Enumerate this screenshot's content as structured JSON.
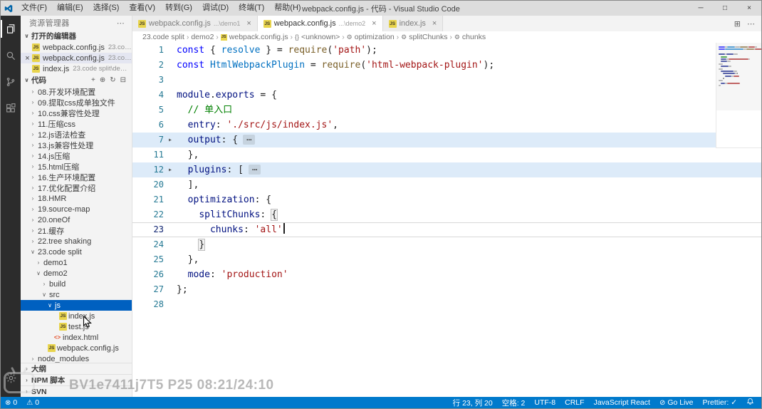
{
  "colors": {
    "accent": "#007acc",
    "titlebar_bg": "#dddddd",
    "activity_bar_bg": "#2c2c2c",
    "sidebar_bg": "#f3f3f3",
    "selection_bg": "#0060c0",
    "fold_highlight": "#ddebf9",
    "editor_bg": "#ffffff",
    "line_number": "#237893",
    "line_number_active": "#0b216f",
    "syntax": {
      "keyword": "#0000ff",
      "variable": "#0070c1",
      "function": "#795e26",
      "string": "#a31515",
      "comment": "#008000",
      "property": "#001080",
      "default": "#1e1e1e"
    }
  },
  "icons": {
    "close": "×",
    "more": "⋯",
    "ellipsis": "⋯",
    "fold_arrow": "▸",
    "chevron_down": "∨",
    "chevron_right": "›",
    "split_editor": "⊞",
    "error": "⊗",
    "warning": "⚠",
    "go_live": "⊘",
    "js_badge": "JS",
    "html_badge": "<>",
    "wrench": "⚙",
    "symbol": "{}",
    "breadcrumb_sep": "›",
    "new_file": "+",
    "new_folder": "⊕",
    "refresh": "↻",
    "collapse_all": "⊟",
    "minimize": "─",
    "maximize": "□"
  },
  "title_bar": {
    "title": "webpack.config.js - 代码 - Visual Studio Code",
    "menus": [
      {
        "name": "file",
        "label": "文件(F)"
      },
      {
        "name": "edit",
        "label": "编辑(E)"
      },
      {
        "name": "selection",
        "label": "选择(S)"
      },
      {
        "name": "view",
        "label": "查看(V)"
      },
      {
        "name": "go",
        "label": "转到(G)"
      },
      {
        "name": "debug",
        "label": "调试(D)"
      },
      {
        "name": "terminal",
        "label": "终端(T)"
      },
      {
        "name": "help",
        "label": "帮助(H)"
      }
    ]
  },
  "activity_bar": {
    "items": [
      {
        "id": "explorer",
        "active": true
      },
      {
        "id": "search",
        "active": false
      },
      {
        "id": "source-control",
        "active": false
      },
      {
        "id": "extensions",
        "active": false
      }
    ],
    "bottom": [
      {
        "id": "settings",
        "active": false
      }
    ]
  },
  "sidebar": {
    "title": "资源管理器",
    "open_editors": {
      "header": "打开的编辑器",
      "items": [
        {
          "name": "webpack.config.js",
          "desc": "23.code ...",
          "icon": "js",
          "active": false
        },
        {
          "name": "webpack.config.js",
          "desc": "23.code ...",
          "icon": "js",
          "active": true
        },
        {
          "name": "index.js",
          "desc": "23.code split\\demo...",
          "icon": "js",
          "active": false
        }
      ]
    },
    "folder": {
      "header": "代码",
      "actions": [
        "new_file",
        "new_folder",
        "refresh",
        "collapse_all"
      ],
      "tree": [
        {
          "label": "08.开发环境配置",
          "indent": 1,
          "chevron": "right"
        },
        {
          "label": "09.提取css成单独文件",
          "indent": 1,
          "chevron": "right"
        },
        {
          "label": "10.css兼容性处理",
          "indent": 1,
          "chevron": "right"
        },
        {
          "label": "11.压缩css",
          "indent": 1,
          "chevron": "right"
        },
        {
          "label": "12.js语法检查",
          "indent": 1,
          "chevron": "right"
        },
        {
          "label": "13.js兼容性处理",
          "indent": 1,
          "chevron": "right"
        },
        {
          "label": "14.js压缩",
          "indent": 1,
          "chevron": "right"
        },
        {
          "label": "15.html压缩",
          "indent": 1,
          "chevron": "right"
        },
        {
          "label": "16.生产环境配置",
          "indent": 1,
          "chevron": "right"
        },
        {
          "label": "17.优化配置介绍",
          "indent": 1,
          "chevron": "right"
        },
        {
          "label": "18.HMR",
          "indent": 1,
          "chevron": "right"
        },
        {
          "label": "19.source-map",
          "indent": 1,
          "chevron": "right"
        },
        {
          "label": "20.oneOf",
          "indent": 1,
          "chevron": "right"
        },
        {
          "label": "21.缓存",
          "indent": 1,
          "chevron": "right"
        },
        {
          "label": "22.tree shaking",
          "indent": 1,
          "chevron": "right"
        },
        {
          "label": "23.code split",
          "indent": 1,
          "chevron": "down"
        },
        {
          "label": "demo1",
          "indent": 2,
          "chevron": "right"
        },
        {
          "label": "demo2",
          "indent": 2,
          "chevron": "down"
        },
        {
          "label": "build",
          "indent": 3,
          "chevron": "right"
        },
        {
          "label": "src",
          "indent": 3,
          "chevron": "down"
        },
        {
          "label": "js",
          "indent": 4,
          "chevron": "down",
          "selected": true
        },
        {
          "label": "index.js",
          "indent": 5,
          "icon": "js"
        },
        {
          "label": "test.js",
          "indent": 5,
          "icon": "js"
        },
        {
          "label": "index.html",
          "indent": 4,
          "icon": "html"
        },
        {
          "label": "webpack.config.js",
          "indent": 3,
          "icon": "js"
        },
        {
          "label": "node_modules",
          "indent": 1,
          "chevron": "right"
        }
      ]
    },
    "bottom_panels": [
      {
        "label": "大纲"
      },
      {
        "label": "NPM 脚本"
      },
      {
        "label": "SVN"
      }
    ]
  },
  "editor": {
    "tabs": [
      {
        "name": "webpack.config.js",
        "desc": "...\\demo1",
        "icon": "js",
        "active": false,
        "close": true
      },
      {
        "name": "webpack.config.js",
        "desc": "...\\demo2",
        "icon": "js",
        "active": true,
        "close": true
      },
      {
        "name": "index.js",
        "desc": "",
        "icon": "js",
        "active": false,
        "close": true
      }
    ],
    "breadcrumb": [
      {
        "label": "23.code split"
      },
      {
        "label": "demo2"
      },
      {
        "label": "webpack.config.js",
        "icon": "js"
      },
      {
        "label": "<unknown>",
        "icon": "symbol"
      },
      {
        "label": "optimization",
        "icon": "wrench"
      },
      {
        "label": "splitChunks",
        "icon": "wrench"
      },
      {
        "label": "chunks",
        "icon": "wrench"
      }
    ],
    "code": {
      "lines": [
        {
          "n": 1,
          "tokens": [
            [
              "k",
              "const "
            ],
            [
              "p",
              "{ "
            ],
            [
              "v",
              "resolve"
            ],
            [
              "p",
              " } = "
            ],
            [
              "f",
              "require"
            ],
            [
              "p",
              "("
            ],
            [
              "s",
              "'path'"
            ],
            [
              "p",
              ");"
            ]
          ]
        },
        {
          "n": 2,
          "tokens": [
            [
              "k",
              "const "
            ],
            [
              "v",
              "HtmlWebpackPlugin"
            ],
            [
              "p",
              " = "
            ],
            [
              "f",
              "require"
            ],
            [
              "p",
              "("
            ],
            [
              "s",
              "'html-webpack-plugin'"
            ],
            [
              "p",
              ");"
            ]
          ]
        },
        {
          "n": 3,
          "tokens": []
        },
        {
          "n": 4,
          "tokens": [
            [
              "n",
              "module"
            ],
            [
              "p",
              "."
            ],
            [
              "n",
              "exports"
            ],
            [
              "p",
              " = {"
            ]
          ]
        },
        {
          "n": 5,
          "tokens": [
            [
              "p",
              "  "
            ],
            [
              "c",
              "// 单入口"
            ]
          ]
        },
        {
          "n": 6,
          "tokens": [
            [
              "p",
              "  "
            ],
            [
              "n",
              "entry"
            ],
            [
              "p",
              ": "
            ],
            [
              "s",
              "'./src/js/index.js'"
            ],
            [
              "p",
              ","
            ]
          ]
        },
        {
          "n": 7,
          "fold": true,
          "hl": true,
          "tokens": [
            [
              "p",
              "  "
            ],
            [
              "n",
              "output"
            ],
            [
              "p",
              ": {"
            ]
          ]
        },
        {
          "n": 11,
          "tokens": [
            [
              "p",
              "  },"
            ]
          ]
        },
        {
          "n": 12,
          "fold": true,
          "hl": true,
          "tokens": [
            [
              "p",
              "  "
            ],
            [
              "n",
              "plugins"
            ],
            [
              "p",
              ": ["
            ]
          ]
        },
        {
          "n": 20,
          "tokens": [
            [
              "p",
              "  ],"
            ]
          ]
        },
        {
          "n": 21,
          "tokens": [
            [
              "p",
              "  "
            ],
            [
              "n",
              "optimization"
            ],
            [
              "p",
              ": {"
            ]
          ]
        },
        {
          "n": 22,
          "tokens": [
            [
              "p",
              "    "
            ],
            [
              "n",
              "splitChunks"
            ],
            [
              "p",
              ": "
            ],
            [
              "b",
              "{"
            ]
          ]
        },
        {
          "n": 23,
          "current": true,
          "tokens": [
            [
              "p",
              "      "
            ],
            [
              "n",
              "chunks"
            ],
            [
              "p",
              ": "
            ],
            [
              "s",
              "'all'"
            ]
          ]
        },
        {
          "n": 24,
          "tokens": [
            [
              "p",
              "    "
            ],
            [
              "b",
              "}"
            ]
          ]
        },
        {
          "n": 25,
          "tokens": [
            [
              "p",
              "  },"
            ]
          ]
        },
        {
          "n": 26,
          "tokens": [
            [
              "p",
              "  "
            ],
            [
              "n",
              "mode"
            ],
            [
              "p",
              ": "
            ],
            [
              "s",
              "'production'"
            ]
          ]
        },
        {
          "n": 27,
          "tokens": [
            [
              "p",
              "};"
            ]
          ]
        },
        {
          "n": 28,
          "tokens": []
        }
      ]
    },
    "watermark": "BV1e7411j7T5 P25 08:21/24:10"
  },
  "status_bar": {
    "left": [
      {
        "name": "status-errors",
        "icon": "error",
        "text": "0"
      },
      {
        "name": "status-warnings",
        "icon": "warning",
        "text": "0"
      }
    ],
    "right": [
      {
        "name": "status-cursor-position",
        "text": "行 23, 列 20"
      },
      {
        "name": "status-indentation",
        "text": "空格: 2"
      },
      {
        "name": "status-encoding",
        "text": "UTF-8"
      },
      {
        "name": "status-eol",
        "text": "CRLF"
      },
      {
        "name": "status-language",
        "text": "JavaScript React"
      },
      {
        "name": "status-go-live",
        "icon": "go_live",
        "text": "Go Live"
      },
      {
        "name": "status-prettier",
        "text": "Prettier: ✓"
      },
      {
        "name": "status-bell",
        "icon": "bell",
        "text": ""
      }
    ]
  }
}
